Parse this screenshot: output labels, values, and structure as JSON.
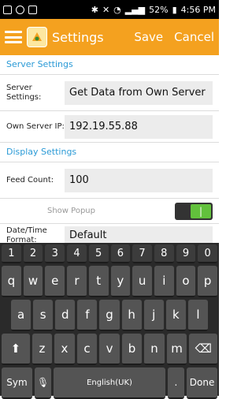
{
  "status_bar": {
    "battery": "52%",
    "time": "4:56 PM"
  },
  "action_bar": {
    "title": "Settings",
    "save": "Save",
    "cancel": "Cancel"
  },
  "settings": {
    "server_section": "Server Settings",
    "server_settings_label": "Server Settings:",
    "server_settings_value": "Get Data from Own Server",
    "own_server_ip_label": "Own Server IP:",
    "own_server_ip_value": "192.19.55.88",
    "display_section": "Display Settings",
    "feed_count_label": "Feed Count:",
    "feed_count_value": "100",
    "show_popup_label": "Show Popup",
    "show_popup_on": true,
    "datetime_label": "Date/Time Format:",
    "datetime_value": "Default"
  },
  "keyboard": {
    "numbers": [
      "1",
      "2",
      "3",
      "4",
      "5",
      "6",
      "7",
      "8",
      "9",
      "0"
    ],
    "row1": [
      "q",
      "w",
      "e",
      "r",
      "t",
      "y",
      "u",
      "i",
      "o",
      "p"
    ],
    "row2": [
      "a",
      "s",
      "d",
      "f",
      "g",
      "h",
      "j",
      "k",
      "l"
    ],
    "row3": [
      "z",
      "x",
      "c",
      "v",
      "b",
      "n",
      "m"
    ],
    "sym": "Sym",
    "space": "English(UK)",
    "period": ".",
    "done": "Done"
  }
}
